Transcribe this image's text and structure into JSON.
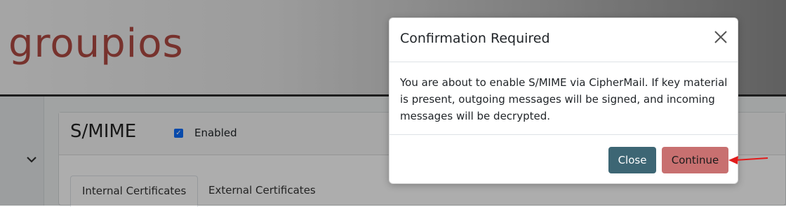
{
  "header": {
    "logo_text": "groupios"
  },
  "card": {
    "title": "S/MIME",
    "enabled_label": "Enabled",
    "tabs": [
      {
        "label": "Internal Certificates"
      },
      {
        "label": "External Certificates"
      }
    ]
  },
  "modal": {
    "title": "Confirmation Required",
    "body": "You are about to enable S/MIME via CipherMail. If key material is present, outgoing messages will be signed, and incoming messages will be decrypted.",
    "close_label": "Close",
    "continue_label": "Continue"
  },
  "icons": {
    "chevron": "chevron-down-icon",
    "close": "close-icon",
    "checkbox": "checkbox-checked-icon",
    "arrow": "red-arrow-annotation"
  },
  "colors": {
    "logo": "#b04a43",
    "close_button": "#3d6674",
    "continue_button": "#c87070",
    "annotation_arrow": "#e21b1b"
  }
}
